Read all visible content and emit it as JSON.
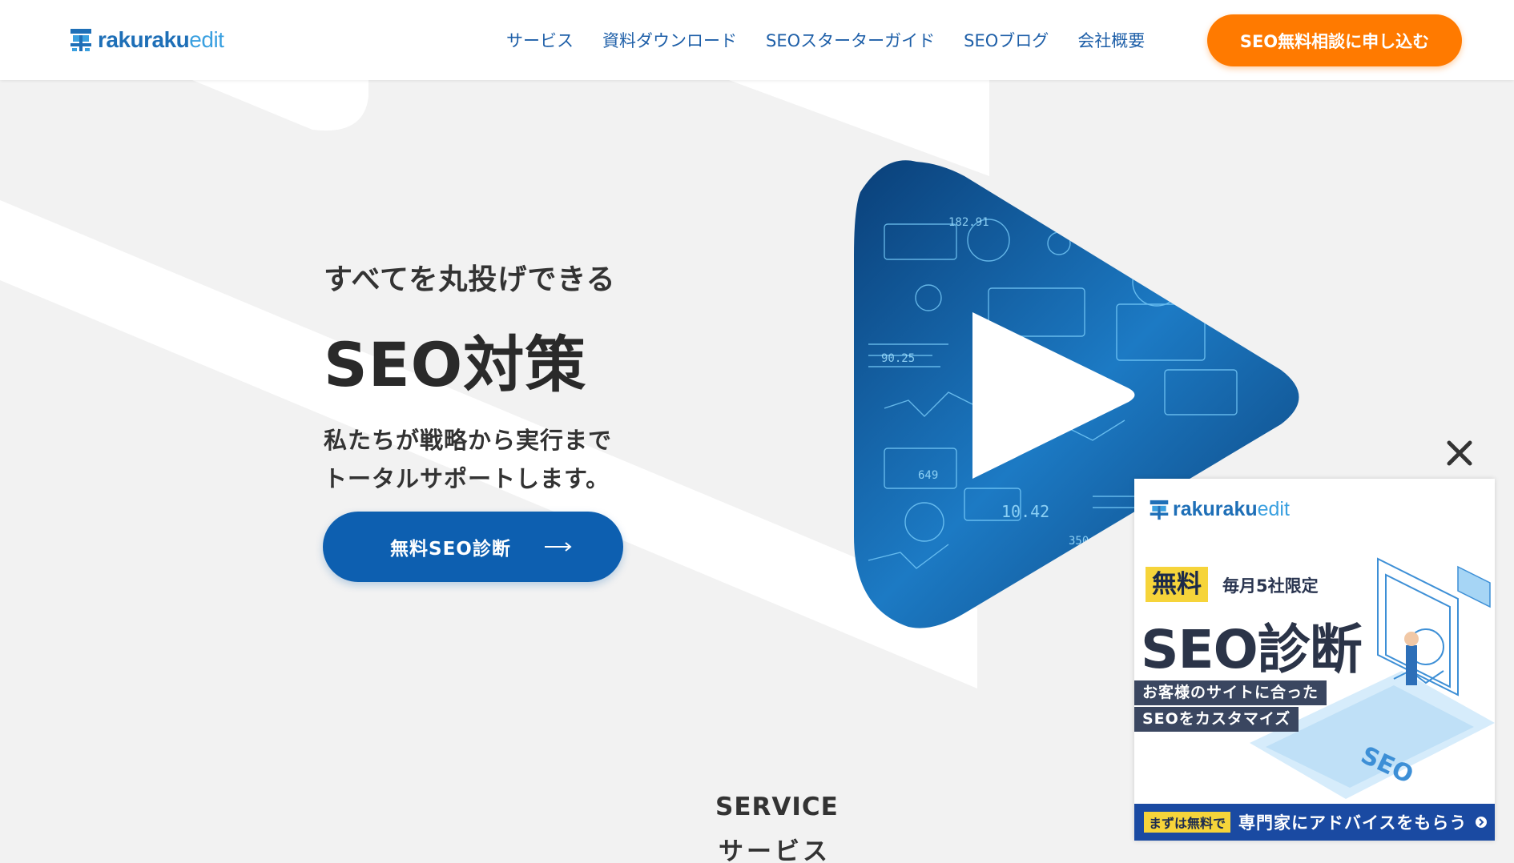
{
  "header": {
    "logo_text": "rakuraku",
    "logo_accent": "edit",
    "nav": [
      "サービス",
      "資料ダウンロード",
      "SEOスターターガイド",
      "SEOブログ",
      "会社概要"
    ],
    "cta_label": "SEO無料相談に申し込む"
  },
  "hero": {
    "subtitle": "すべてを丸投げできる",
    "title": "SEO対策",
    "desc_line1": "私たちが戦略から実行まで",
    "desc_line2": "トータルサポートします。",
    "button_label": "無料SEO診断"
  },
  "graphic_labels": [
    "182.91",
    "90.25",
    "649",
    "10.42",
    "350"
  ],
  "service": {
    "title_en": "SERVICE",
    "title_ja": "サービス"
  },
  "popup": {
    "logo_text": "rakuraku",
    "logo_accent": "edit",
    "free_badge": "無料",
    "limit_text": "毎月5社限定",
    "title": "SEO診断",
    "tag1": "お客様のサイトに合った",
    "tag2": "SEOをカスタマイズ",
    "illust_text": "SEO",
    "footer_badge": "まずは無料で",
    "footer_text": "専門家にアドバイスをもらう"
  },
  "colors": {
    "primary": "#0d5fb0",
    "cta": "#ff7a00",
    "nav_text": "#1e5fa8",
    "background": "#f2f2f2"
  }
}
